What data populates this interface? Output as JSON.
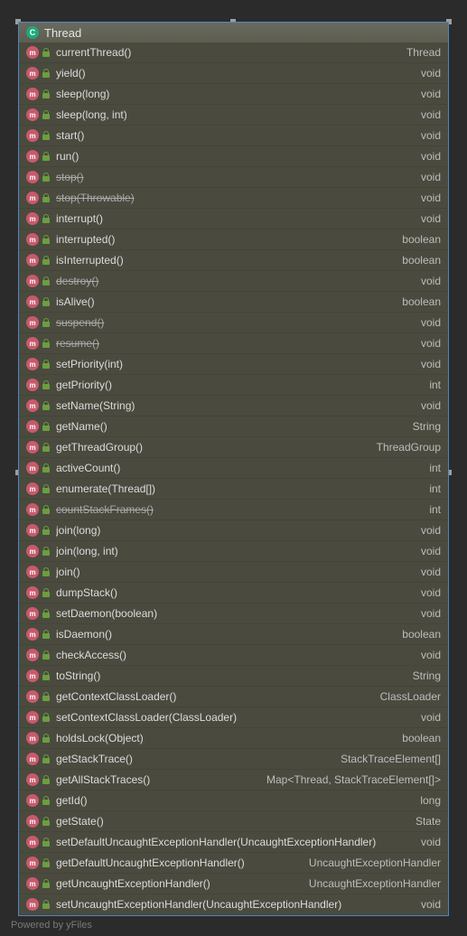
{
  "header": {
    "class_icon_letter": "C",
    "class_name": "Thread"
  },
  "methods": [
    {
      "name": "currentThread()",
      "ret": "Thread",
      "deprecated": false
    },
    {
      "name": "yield()",
      "ret": "void",
      "deprecated": false
    },
    {
      "name": "sleep(long)",
      "ret": "void",
      "deprecated": false
    },
    {
      "name": "sleep(long, int)",
      "ret": "void",
      "deprecated": false
    },
    {
      "name": "start()",
      "ret": "void",
      "deprecated": false
    },
    {
      "name": "run()",
      "ret": "void",
      "deprecated": false
    },
    {
      "name": "stop()",
      "ret": "void",
      "deprecated": true
    },
    {
      "name": "stop(Throwable)",
      "ret": "void",
      "deprecated": true
    },
    {
      "name": "interrupt()",
      "ret": "void",
      "deprecated": false
    },
    {
      "name": "interrupted()",
      "ret": "boolean",
      "deprecated": false
    },
    {
      "name": "isInterrupted()",
      "ret": "boolean",
      "deprecated": false
    },
    {
      "name": "destroy()",
      "ret": "void",
      "deprecated": true
    },
    {
      "name": "isAlive()",
      "ret": "boolean",
      "deprecated": false
    },
    {
      "name": "suspend()",
      "ret": "void",
      "deprecated": true
    },
    {
      "name": "resume()",
      "ret": "void",
      "deprecated": true
    },
    {
      "name": "setPriority(int)",
      "ret": "void",
      "deprecated": false
    },
    {
      "name": "getPriority()",
      "ret": "int",
      "deprecated": false
    },
    {
      "name": "setName(String)",
      "ret": "void",
      "deprecated": false
    },
    {
      "name": "getName()",
      "ret": "String",
      "deprecated": false
    },
    {
      "name": "getThreadGroup()",
      "ret": "ThreadGroup",
      "deprecated": false
    },
    {
      "name": "activeCount()",
      "ret": "int",
      "deprecated": false
    },
    {
      "name": "enumerate(Thread[])",
      "ret": "int",
      "deprecated": false
    },
    {
      "name": "countStackFrames()",
      "ret": "int",
      "deprecated": true
    },
    {
      "name": "join(long)",
      "ret": "void",
      "deprecated": false
    },
    {
      "name": "join(long, int)",
      "ret": "void",
      "deprecated": false
    },
    {
      "name": "join()",
      "ret": "void",
      "deprecated": false
    },
    {
      "name": "dumpStack()",
      "ret": "void",
      "deprecated": false
    },
    {
      "name": "setDaemon(boolean)",
      "ret": "void",
      "deprecated": false
    },
    {
      "name": "isDaemon()",
      "ret": "boolean",
      "deprecated": false
    },
    {
      "name": "checkAccess()",
      "ret": "void",
      "deprecated": false
    },
    {
      "name": "toString()",
      "ret": "String",
      "deprecated": false
    },
    {
      "name": "getContextClassLoader()",
      "ret": "ClassLoader",
      "deprecated": false
    },
    {
      "name": "setContextClassLoader(ClassLoader)",
      "ret": "void",
      "deprecated": false
    },
    {
      "name": "holdsLock(Object)",
      "ret": "boolean",
      "deprecated": false
    },
    {
      "name": "getStackTrace()",
      "ret": "StackTraceElement[]",
      "deprecated": false
    },
    {
      "name": "getAllStackTraces()",
      "ret": "Map<Thread, StackTraceElement[]>",
      "deprecated": false
    },
    {
      "name": "getId()",
      "ret": "long",
      "deprecated": false
    },
    {
      "name": "getState()",
      "ret": "State",
      "deprecated": false
    },
    {
      "name": "setDefaultUncaughtExceptionHandler(UncaughtExceptionHandler)",
      "ret": "void",
      "deprecated": false
    },
    {
      "name": "getDefaultUncaughtExceptionHandler()",
      "ret": "UncaughtExceptionHandler",
      "deprecated": false
    },
    {
      "name": "getUncaughtExceptionHandler()",
      "ret": "UncaughtExceptionHandler",
      "deprecated": false
    },
    {
      "name": "setUncaughtExceptionHandler(UncaughtExceptionHandler)",
      "ret": "void",
      "deprecated": false
    }
  ],
  "watermark": "Powered by yFiles",
  "method_icon_letter": "m"
}
